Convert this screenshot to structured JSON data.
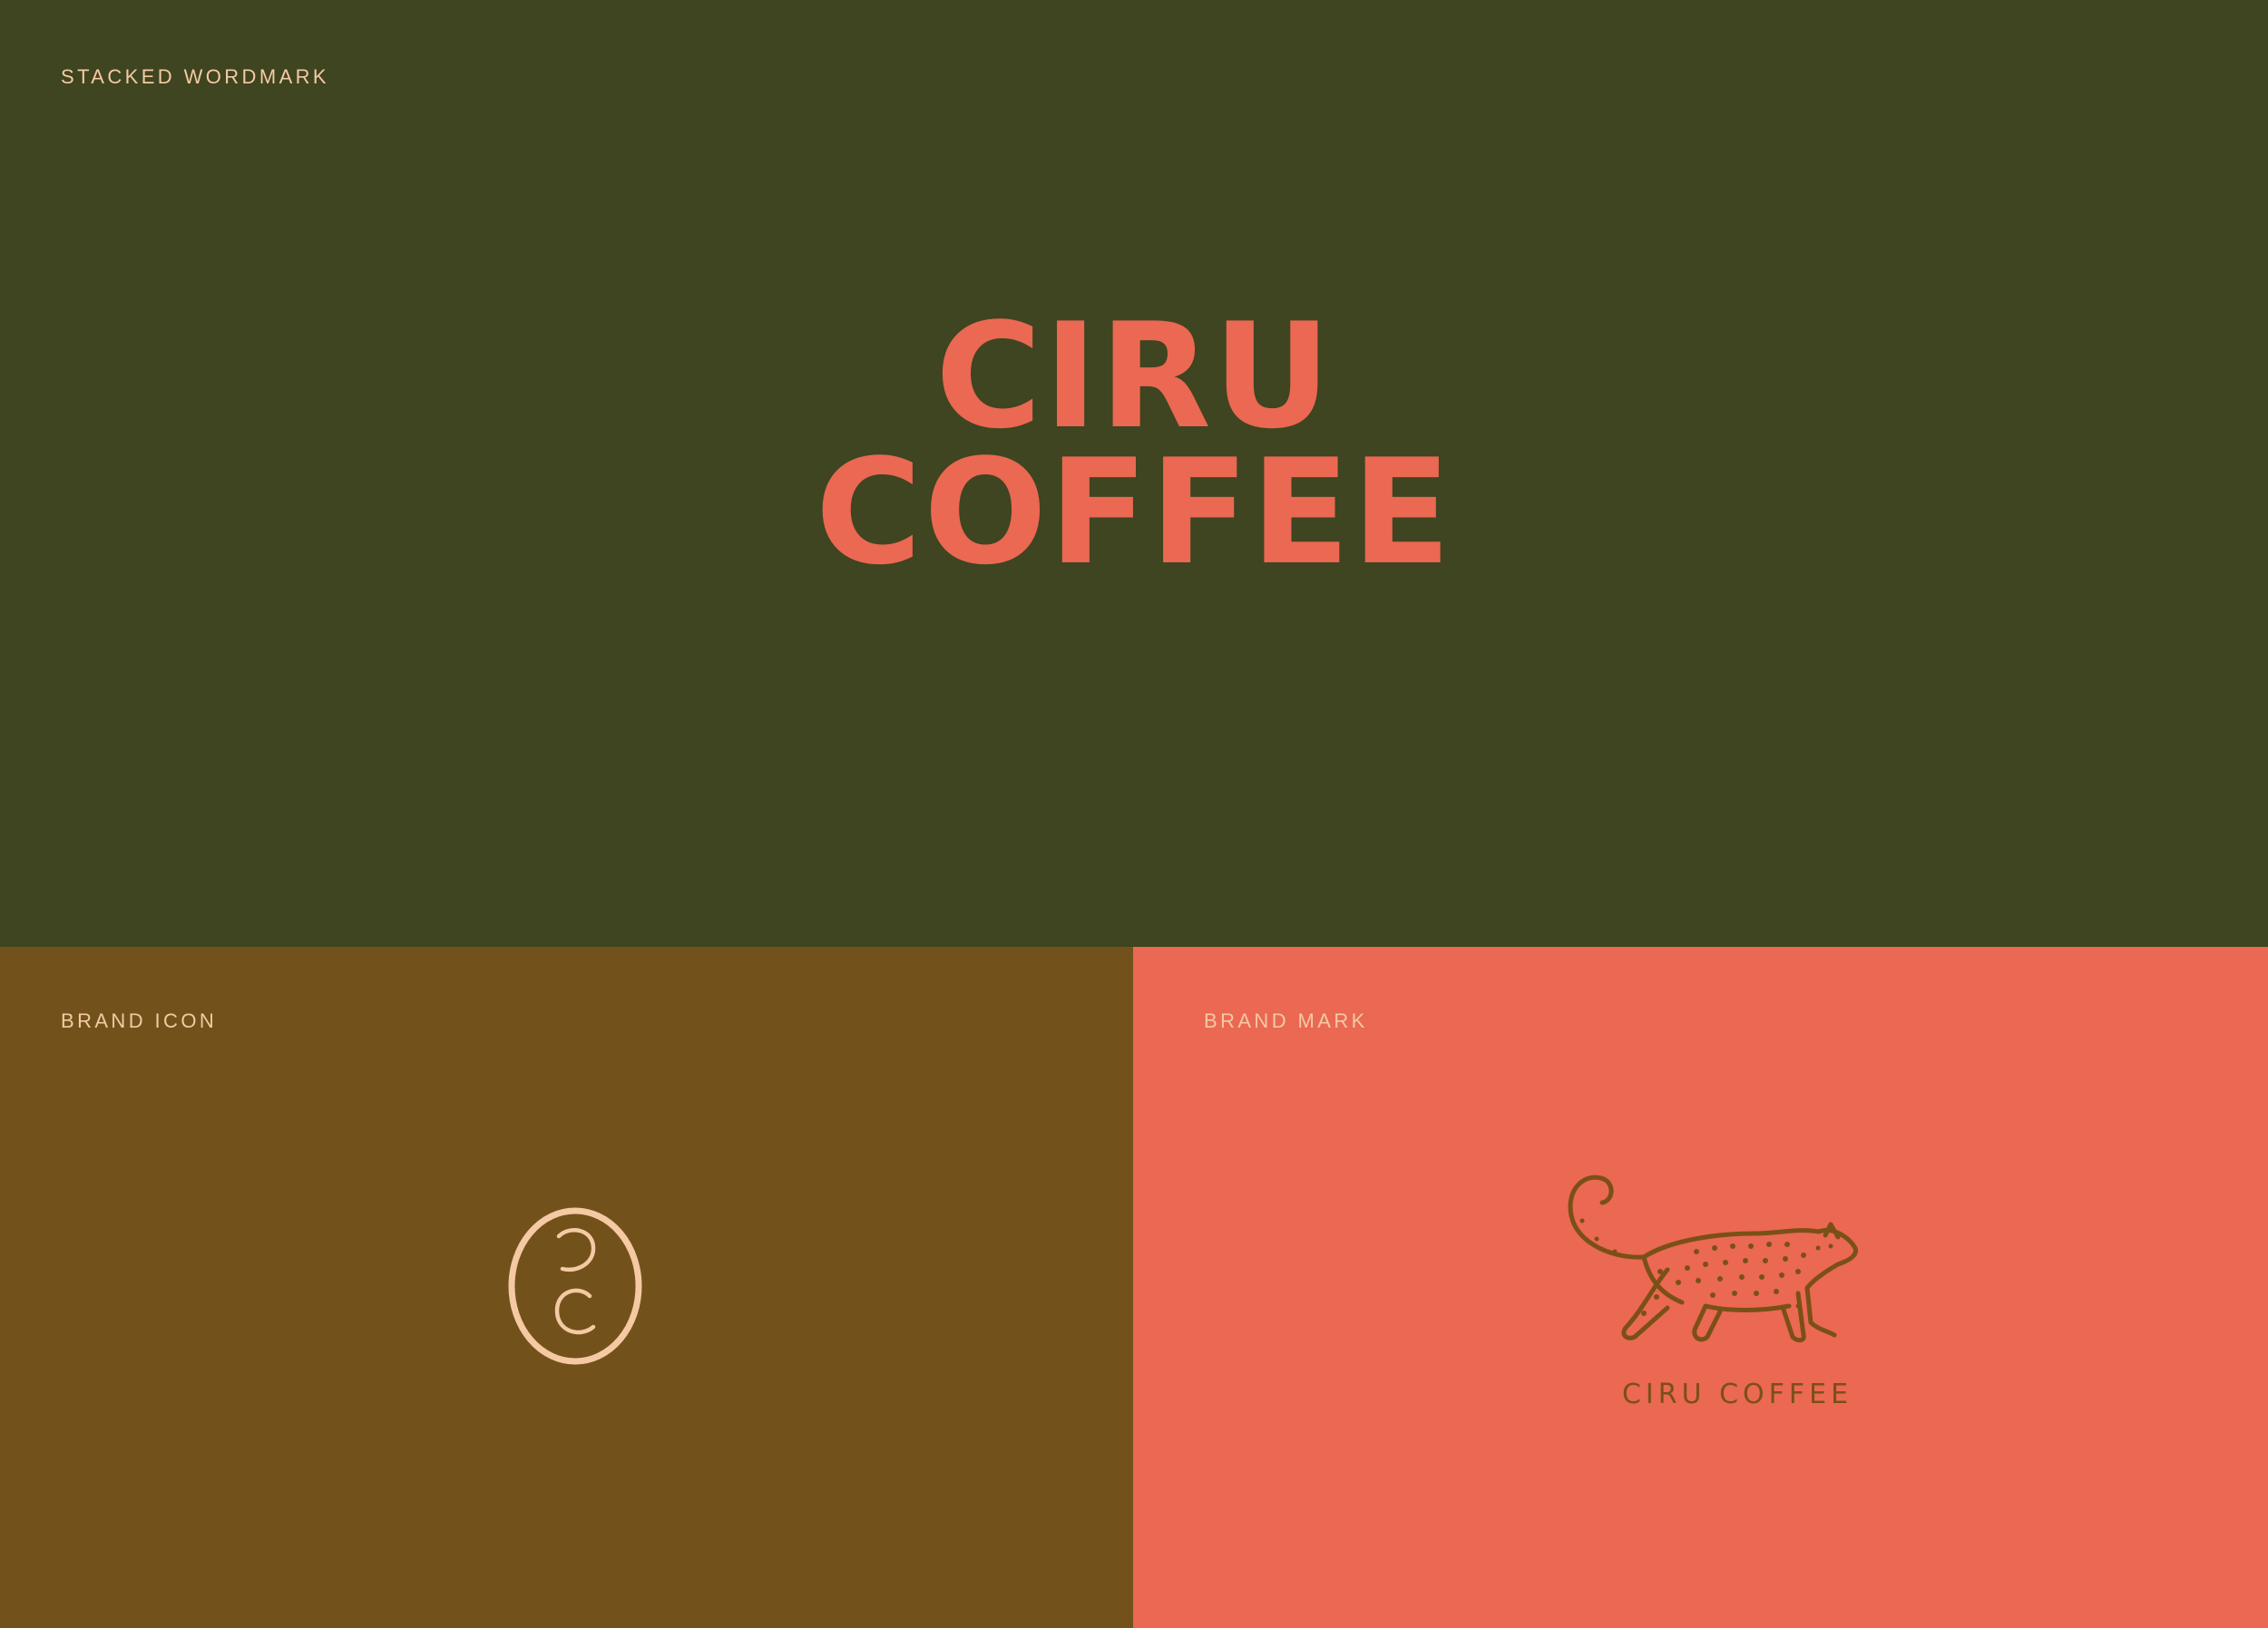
{
  "colors": {
    "olive": "#3e4520",
    "ochre": "#72521a",
    "coral": "#eb6853",
    "cream": "#f5c9a3",
    "leopard": "#7a5017"
  },
  "panels": {
    "stacked_wordmark": {
      "label": "STACKED WORDMARK",
      "line1": "CIRU",
      "line2": "COFFEE"
    },
    "brand_icon": {
      "label": "BRAND ICON",
      "icon": "cc-monogram-oval-icon"
    },
    "brand_mark": {
      "label": "BRAND MARK",
      "illustration": "leopard-icon",
      "name": "CIRU COFFEE"
    }
  }
}
